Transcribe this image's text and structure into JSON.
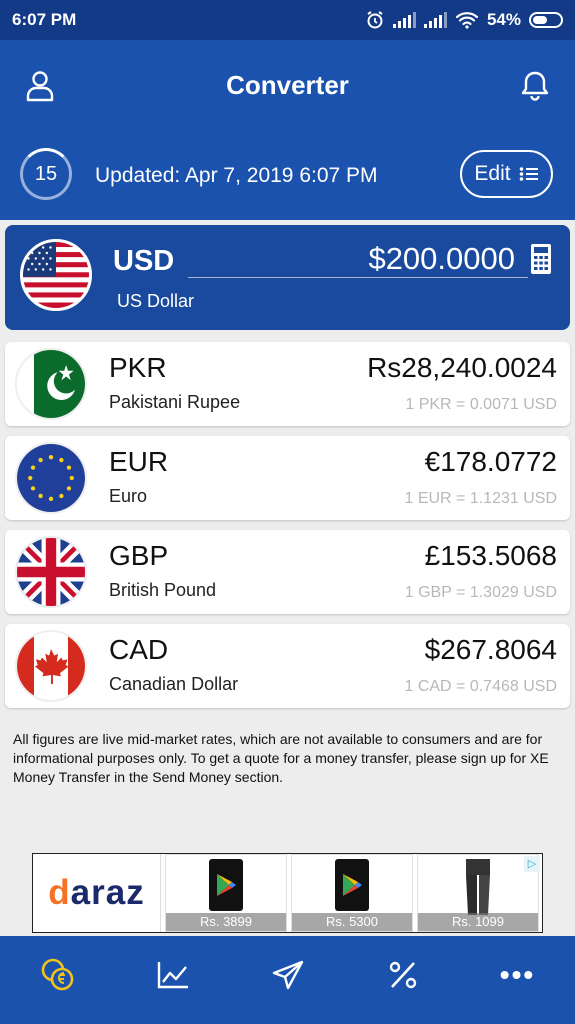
{
  "status_bar": {
    "time": "6:07 PM",
    "battery": "54%"
  },
  "app_bar": {
    "title": "Converter",
    "countdown": "15",
    "updated": "Updated: Apr 7, 2019 6:07 PM",
    "edit_label": "Edit"
  },
  "base": {
    "code": "USD",
    "name": "US Dollar",
    "amount": "$200.0000"
  },
  "conversions": [
    {
      "code": "PKR",
      "name": "Pakistani Rupee",
      "amount": "Rs28,240.0024",
      "rate": "1 PKR = 0.0071 USD"
    },
    {
      "code": "EUR",
      "name": "Euro",
      "amount": "€178.0772",
      "rate": "1 EUR = 1.1231 USD"
    },
    {
      "code": "GBP",
      "name": "British Pound",
      "amount": "£153.5068",
      "rate": "1 GBP = 1.3029 USD"
    },
    {
      "code": "CAD",
      "name": "Canadian Dollar",
      "amount": "$267.8064",
      "rate": "1 CAD = 0.7468 USD"
    }
  ],
  "disclaimer": "All figures are live mid-market rates, which are not available to consumers and are for informational purposes only. To get a quote for a money transfer, please sign up for XE Money Transfer in the Send Money section.",
  "ad": {
    "brand": "daraz",
    "prices": [
      "Rs. 3899",
      "Rs. 5300",
      "Rs. 1099"
    ]
  },
  "icons": [
    "profile-icon",
    "bell-icon",
    "calculator-icon",
    "list-icon",
    "converter-coins-icon",
    "chart-icon",
    "send-icon",
    "percent-icon",
    "more-icon",
    "alarm-icon",
    "wifi-icon"
  ],
  "colors": {
    "primary": "#1a52ae",
    "dark": "#123a86",
    "base_card": "#1a4a9e",
    "active_nav": "#f2c21b"
  }
}
